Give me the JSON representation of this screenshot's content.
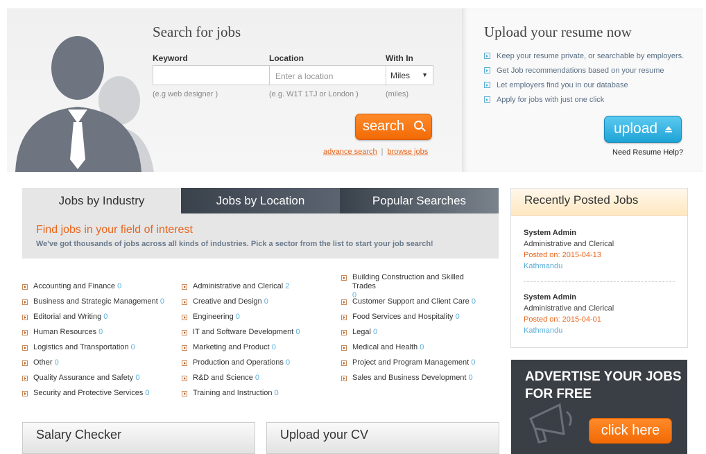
{
  "search": {
    "title": "Search for jobs",
    "keyword_label": "Keyword",
    "keyword_value": "",
    "keyword_hint": "(e.g web designer )",
    "location_label": "Location",
    "location_placeholder": "Enter a location",
    "location_hint": "(e.g. W1T 1TJ or London )",
    "within_label": "With In",
    "within_value": "Miles",
    "within_hint": "(miles)",
    "button_label": "search",
    "advance_search": "advance search",
    "separator": "|",
    "browse_jobs": "browse jobs"
  },
  "upload": {
    "title": "Upload your resume now",
    "benefits": [
      "Keep your resume private, or searchable by employers.",
      "Get Job recommendations based on your resume",
      "Let employers find you in our database",
      "Apply for jobs with just one click"
    ],
    "button_label": "upload",
    "help": "Need Resume Help?"
  },
  "tabs": [
    "Jobs by Industry",
    "Jobs by Location",
    "Popular Searches"
  ],
  "intro": {
    "heading": "Find jobs in your field of interest",
    "text": "We've got thousands of jobs across all kinds of industries. Pick a sector from the list to start your job search!"
  },
  "industries": {
    "col1": [
      {
        "name": "Accounting and Finance",
        "count": "0"
      },
      {
        "name": "Business and Strategic Management",
        "count": "0"
      },
      {
        "name": "Editorial and Writing",
        "count": "0"
      },
      {
        "name": "Human Resources",
        "count": "0"
      },
      {
        "name": "Logistics and Transportation",
        "count": "0"
      },
      {
        "name": "Other",
        "count": "0"
      },
      {
        "name": "Quality Assurance and Safety",
        "count": "0"
      },
      {
        "name": "Security and Protective Services",
        "count": "0"
      }
    ],
    "col2": [
      {
        "name": "Administrative and Clerical",
        "count": "2"
      },
      {
        "name": "Creative and Design",
        "count": "0"
      },
      {
        "name": "Engineering",
        "count": "0"
      },
      {
        "name": "IT and Software Development",
        "count": "0"
      },
      {
        "name": "Marketing and Product",
        "count": "0"
      },
      {
        "name": "Production and Operations",
        "count": "0"
      },
      {
        "name": "R&D and Science",
        "count": "0"
      },
      {
        "name": "Training and Instruction",
        "count": "0"
      }
    ],
    "col3": [
      {
        "name": "Building Construction and Skilled Trades",
        "count": "0"
      },
      {
        "name": "Customer Support and Client Care",
        "count": "0"
      },
      {
        "name": "Food Services and Hospitality",
        "count": "0"
      },
      {
        "name": "Legal",
        "count": "0"
      },
      {
        "name": "Medical and Health",
        "count": "0"
      },
      {
        "name": "Project and Program Management",
        "count": "0"
      },
      {
        "name": "Sales and Business Development",
        "count": "0"
      }
    ]
  },
  "panels": {
    "salary": "Salary Checker",
    "cv": "Upload your CV"
  },
  "recent": {
    "title": "Recently Posted Jobs",
    "jobs": [
      {
        "title": "System Admin",
        "category": "Administrative and Clerical",
        "posted": "Posted on: 2015-04-13",
        "location": "Kathmandu"
      },
      {
        "title": "System Admin",
        "category": "Administrative and Clerical",
        "posted": "Posted on: 2015-04-01",
        "location": "Kathmandu"
      }
    ]
  },
  "advert": {
    "line1": "ADVERTISE YOUR JOBS",
    "line2": "FOR FREE",
    "button_label": "click here"
  },
  "colors": {
    "accent_orange": "#f26a05",
    "accent_blue": "#1ea3d6",
    "tab_dark": "#39414b",
    "link_blue": "#5aaed8"
  }
}
